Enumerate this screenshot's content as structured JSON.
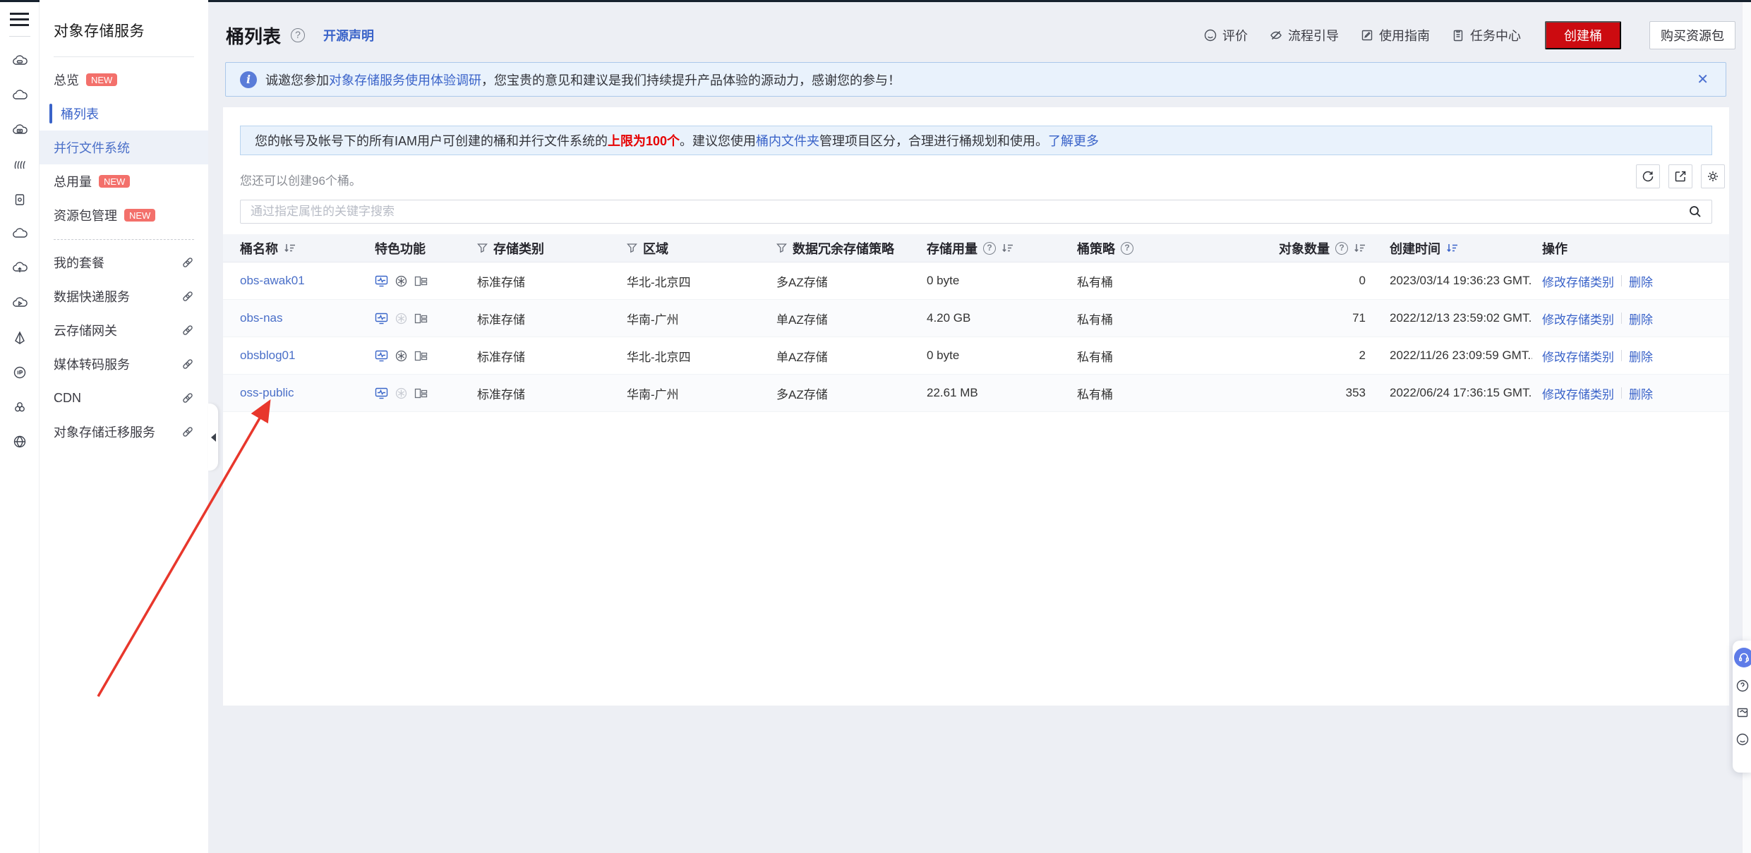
{
  "sidebar": {
    "title": "对象存储服务",
    "items": [
      {
        "label": "总览",
        "badge": "NEW"
      },
      {
        "label": "桶列表",
        "active": true
      },
      {
        "label": "并行文件系统",
        "highlighted": true
      },
      {
        "label": "总用量",
        "badge": "NEW"
      },
      {
        "label": "资源包管理",
        "badge": "NEW"
      }
    ],
    "external_items": [
      {
        "label": "我的套餐"
      },
      {
        "label": "数据快递服务"
      },
      {
        "label": "云存储网关"
      },
      {
        "label": "媒体转码服务"
      },
      {
        "label": "CDN"
      },
      {
        "label": "对象存储迁移服务"
      }
    ]
  },
  "header": {
    "title": "桶列表",
    "opensource_link": "开源声明",
    "actions": [
      {
        "label": "评价"
      },
      {
        "label": "流程引导"
      },
      {
        "label": "使用指南"
      },
      {
        "label": "任务中心"
      }
    ],
    "create_button": "创建桶",
    "buy_button": "购买资源包"
  },
  "banner": {
    "pre": "诚邀您参加",
    "link": "对象存储服务使用体验调研",
    "post": "，您宝贵的意见和建议是我们持续提升产品体验的源动力，感谢您的参与！",
    "close": "✕"
  },
  "notice": {
    "pre": "您的帐号及帐号下的所有IAM用户可创建的桶和并行文件系统的",
    "limit": "上限为100个",
    "mid": "。建议您使用",
    "folder_link": "桶内文件夹",
    "mid2": "管理项目区分，合理进行桶规划和使用。",
    "more_link": "了解更多"
  },
  "quota_text": "您还可以创建96个桶。",
  "search": {
    "placeholder": "通过指定属性的关键字搜索"
  },
  "table": {
    "columns": [
      {
        "label": "桶名称"
      },
      {
        "label": "特色功能"
      },
      {
        "label": "存储类别"
      },
      {
        "label": "区域"
      },
      {
        "label": "数据冗余存储策略"
      },
      {
        "label": "存储用量"
      },
      {
        "label": "桶策略"
      },
      {
        "label": "对象数量"
      },
      {
        "label": "创建时间"
      },
      {
        "label": "操作"
      }
    ],
    "action_modify": "修改存储类别",
    "action_delete": "删除",
    "buckets": [
      {
        "name": "obs-awak01",
        "storage_class": "标准存储",
        "region": "华北-北京四",
        "redundancy": "多AZ存储",
        "usage": "0 byte",
        "policy": "私有桶",
        "objects": "0",
        "created": "2023/03/14 19:36:23 GMT...",
        "az_dim": false
      },
      {
        "name": "obs-nas",
        "storage_class": "标准存储",
        "region": "华南-广州",
        "redundancy": "单AZ存储",
        "usage": "4.20 GB",
        "policy": "私有桶",
        "objects": "71",
        "created": "2022/12/13 23:59:02 GMT...",
        "az_dim": true
      },
      {
        "name": "obsblog01",
        "storage_class": "标准存储",
        "region": "华北-北京四",
        "redundancy": "单AZ存储",
        "usage": "0 byte",
        "policy": "私有桶",
        "objects": "2",
        "created": "2022/11/26 23:09:59 GMT...",
        "az_dim": false
      },
      {
        "name": "oss-public",
        "storage_class": "标准存储",
        "region": "华南-广州",
        "redundancy": "多AZ存储",
        "usage": "22.61 MB",
        "policy": "私有桶",
        "objects": "353",
        "created": "2022/06/24 17:36:15 GMT...",
        "az_dim": true
      }
    ]
  },
  "colors": {
    "accent_red": "#cc0b10",
    "link_blue": "#3a63c9",
    "badge_red": "#f3706b",
    "arrow_red": "#e8372c",
    "banner_bg": "#e9f2fc",
    "limit_red": "#e60000",
    "page_bg": "#edeff4"
  }
}
